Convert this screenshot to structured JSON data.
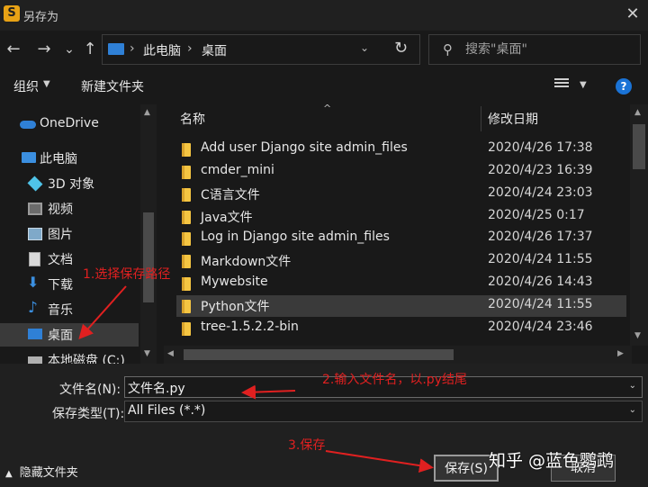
{
  "window": {
    "title": "另存为",
    "app_icon_letter": "S",
    "close_label": "✕"
  },
  "nav": {
    "back": "←",
    "forward": "→",
    "recent": "⌄",
    "up": "↑",
    "address": [
      "此电脑",
      "桌面"
    ],
    "refresh": "↻",
    "search_placeholder": "搜索\"桌面\""
  },
  "toolbar": {
    "organize": "组织",
    "new_folder": "新建文件夹",
    "help": "?"
  },
  "sidebar": {
    "items": [
      {
        "label": "OneDrive",
        "icon": "cloud-icon"
      },
      {
        "label": "此电脑",
        "icon": "computer-icon"
      },
      {
        "label": "3D 对象",
        "icon": "3d-objects-icon"
      },
      {
        "label": "视频",
        "icon": "video-icon"
      },
      {
        "label": "图片",
        "icon": "pictures-icon"
      },
      {
        "label": "文档",
        "icon": "documents-icon"
      },
      {
        "label": "下载",
        "icon": "download-icon"
      },
      {
        "label": "音乐",
        "icon": "music-icon"
      },
      {
        "label": "桌面",
        "icon": "desktop-icon",
        "selected": true
      },
      {
        "label": "本地磁盘 (C:)",
        "icon": "drive-icon"
      }
    ]
  },
  "filelist": {
    "col_name": "名称",
    "col_date": "修改日期",
    "rows": [
      {
        "name": "Add user   Django site admin_files",
        "date": "2020/4/26 17:38"
      },
      {
        "name": "cmder_mini",
        "date": "2020/4/23 16:39"
      },
      {
        "name": "C语言文件",
        "date": "2020/4/24 23:03"
      },
      {
        "name": "Java文件",
        "date": "2020/4/25 0:17"
      },
      {
        "name": "Log in   Django site admin_files",
        "date": "2020/4/26 17:37"
      },
      {
        "name": "Markdown文件",
        "date": "2020/4/24 11:55"
      },
      {
        "name": "Mywebsite",
        "date": "2020/4/26 14:43"
      },
      {
        "name": "Python文件",
        "date": "2020/4/24 11:55",
        "selected": true
      },
      {
        "name": "tree-1.5.2.2-bin",
        "date": "2020/4/24 23:46"
      }
    ]
  },
  "form": {
    "filename_label": "文件名(N):",
    "filename_value": "文件名.py",
    "type_label": "保存类型(T):",
    "type_value": "All Files (*.*)",
    "hide_folders": "隐藏文件夹",
    "save": "保存(S)",
    "cancel": "取消"
  },
  "annotations": {
    "step1": "1.选择保存路径",
    "step2": "2.输入文件名，以.py结尾",
    "step3": "3.保存",
    "color": "#e02020"
  },
  "watermark": "知乎 @蓝色鹦鹉"
}
